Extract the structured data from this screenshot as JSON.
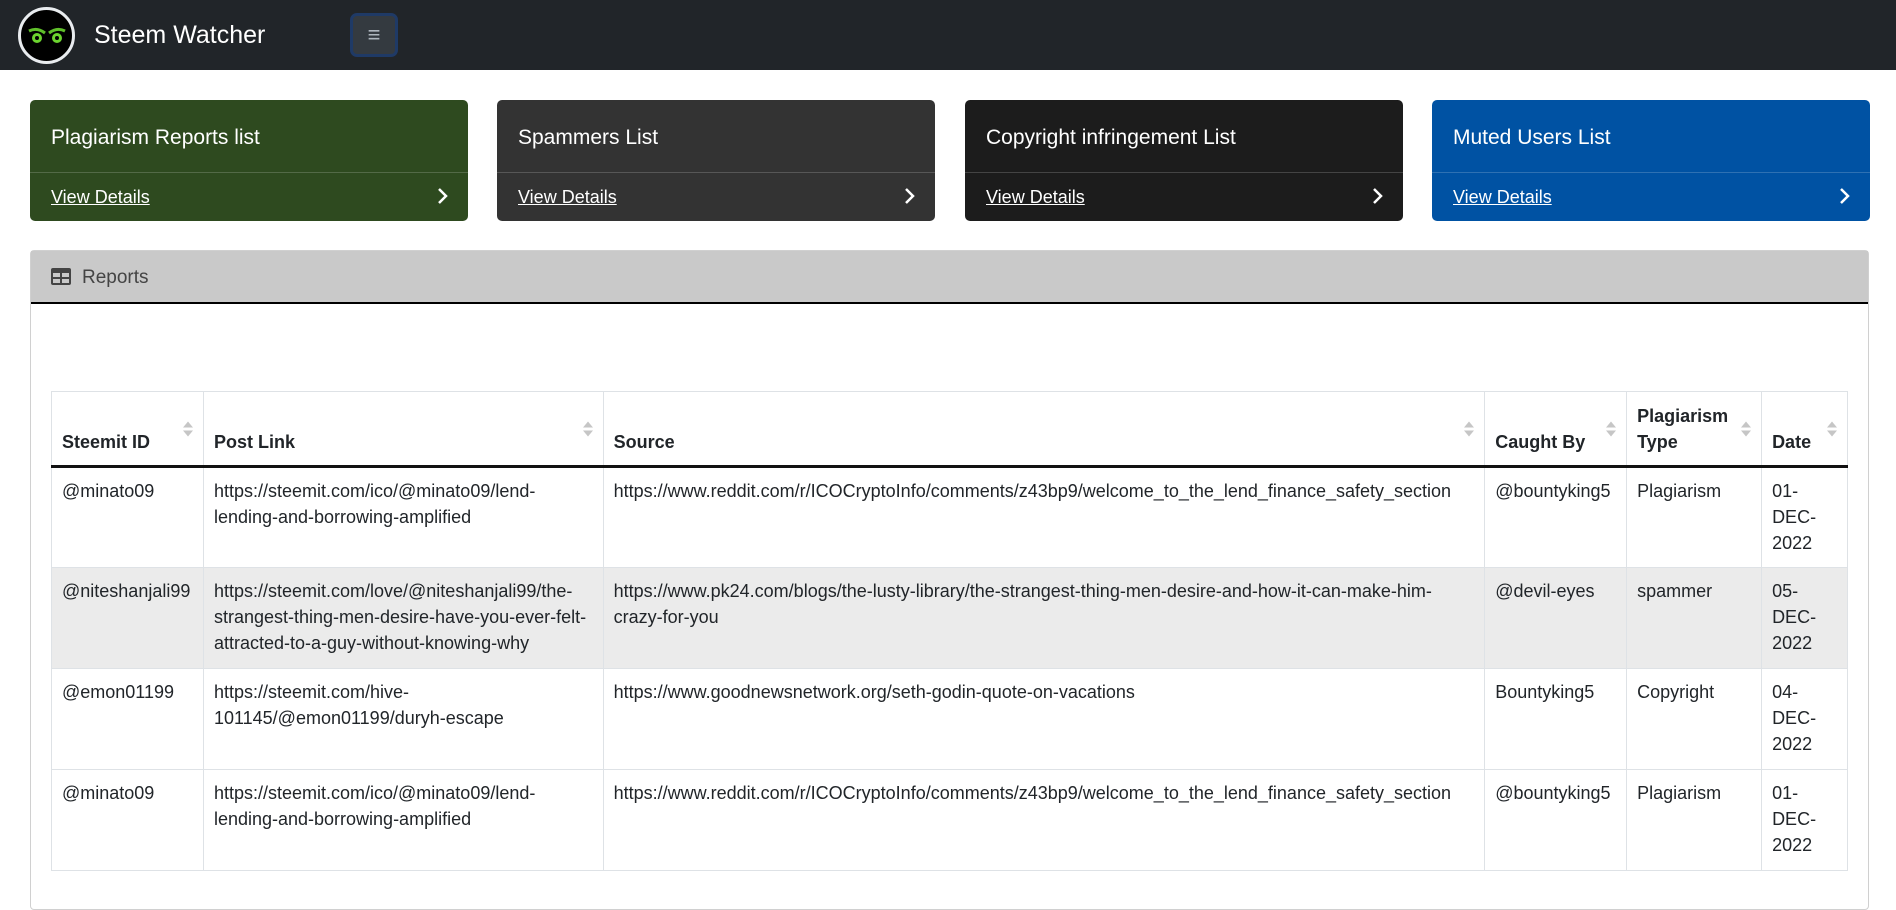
{
  "app": {
    "title": "Steem Watcher",
    "logo_icon": "owl-eyes-icon",
    "menu_icon": "hamburger-icon"
  },
  "cards": [
    {
      "title": "Plagiarism Reports list",
      "link": "View Details",
      "color": "#2e4a1f"
    },
    {
      "title": "Spammers List",
      "link": "View Details",
      "color": "#333333"
    },
    {
      "title": "Copyright infringement List",
      "link": "View Details",
      "color": "#1c1c1c"
    },
    {
      "title": "Muted Users List",
      "link": "View Details",
      "color": "#0052a3"
    }
  ],
  "reports": {
    "title": "Reports",
    "icon": "table-icon",
    "columns": [
      "Steemit ID",
      "Post Link",
      "Source",
      "Caught By",
      "Plagiarism Type",
      "Date"
    ],
    "rows": [
      [
        "@minato09",
        "https://steemit.com/ico/@minato09/lend-lending-and-borrowing-amplified",
        "https://www.reddit.com/r/ICOCryptoInfo/comments/z43bp9/welcome_to_the_lend_finance_safety_section",
        "@bountyking5",
        "Plagiarism",
        "01-DEC-2022"
      ],
      [
        "@niteshanjali99",
        "https://steemit.com/love/@niteshanjali99/the-strangest-thing-men-desire-have-you-ever-felt-attracted-to-a-guy-without-knowing-why",
        "https://www.pk24.com/blogs/the-lusty-library/the-strangest-thing-men-desire-and-how-it-can-make-him-crazy-for-you",
        "@devil-eyes",
        "spammer",
        "05-DEC-2022"
      ],
      [
        "@emon01199",
        "https://steemit.com/hive-101145/@emon01199/duryh-escape",
        "https://www.goodnewsnetwork.org/seth-godin-quote-on-vacations",
        "Bountyking5",
        "Copyright",
        "04-DEC-2022"
      ],
      [
        "@minato09",
        "https://steemit.com/ico/@minato09/lend-lending-and-borrowing-amplified",
        "https://www.reddit.com/r/ICOCryptoInfo/comments/z43bp9/welcome_to_the_lend_finance_safety_section",
        "@bountyking5",
        "Plagiarism",
        "01-DEC-2022"
      ]
    ]
  }
}
